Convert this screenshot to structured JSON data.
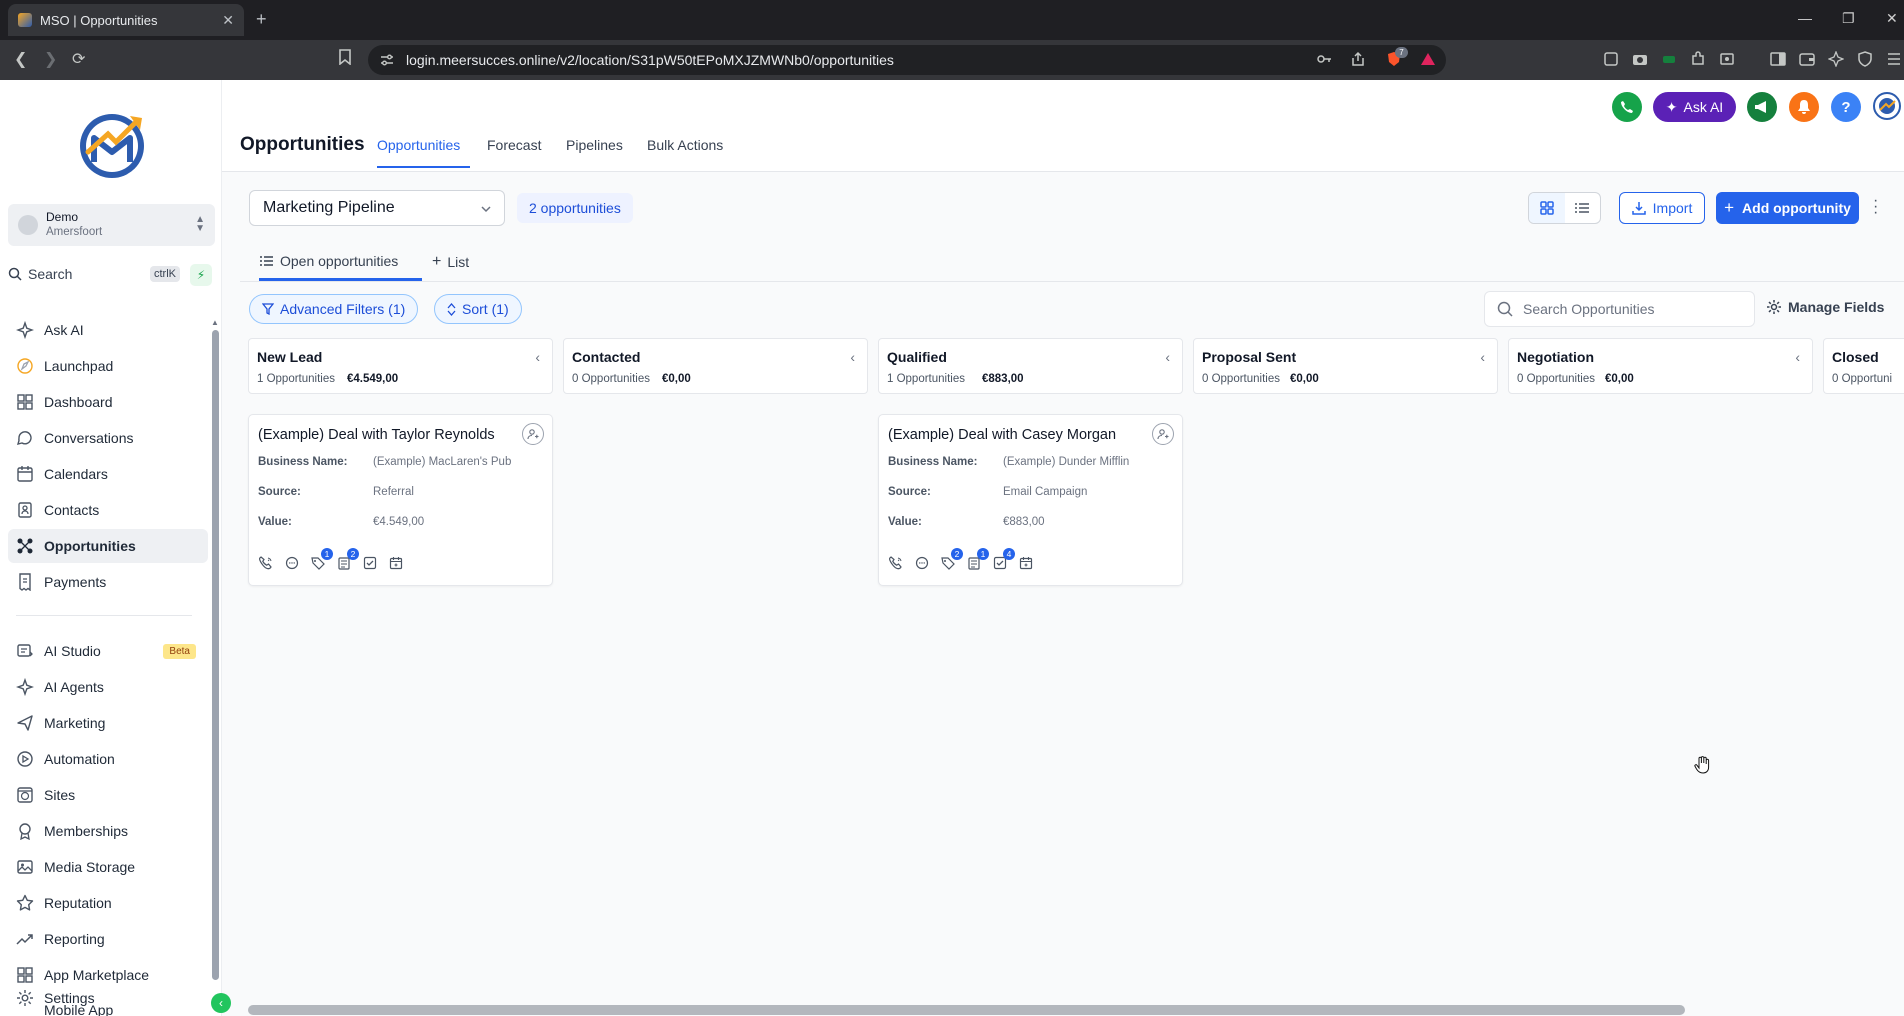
{
  "browser": {
    "tab_title": "MSO | Opportunities",
    "url": "login.meersucces.online/v2/location/S31pW50tEPoMXJZMWNb0/opportunities",
    "ext_badge_count": "7"
  },
  "sidebar": {
    "account_name": "Demo",
    "account_location": "Amersfoort",
    "search_label": "Search",
    "search_shortcut": "ctrlK",
    "items": [
      {
        "label": "Ask AI",
        "icon": "sparkle-icon"
      },
      {
        "label": "Launchpad",
        "icon": "rocket-icon"
      },
      {
        "label": "Dashboard",
        "icon": "grid-icon"
      },
      {
        "label": "Conversations",
        "icon": "chat-icon"
      },
      {
        "label": "Calendars",
        "icon": "calendar-icon"
      },
      {
        "label": "Contacts",
        "icon": "contact-icon"
      },
      {
        "label": "Opportunities",
        "icon": "funnel-icon"
      },
      {
        "label": "Payments",
        "icon": "receipt-icon"
      }
    ],
    "items2": [
      {
        "label": "AI Studio",
        "icon": "ai-studio-icon",
        "badge": "Beta"
      },
      {
        "label": "AI Agents",
        "icon": "sparkle-icon"
      },
      {
        "label": "Marketing",
        "icon": "send-icon"
      },
      {
        "label": "Automation",
        "icon": "automation-icon"
      },
      {
        "label": "Sites",
        "icon": "globe-icon"
      },
      {
        "label": "Memberships",
        "icon": "award-icon"
      },
      {
        "label": "Media Storage",
        "icon": "image-icon"
      },
      {
        "label": "Reputation",
        "icon": "star-icon"
      },
      {
        "label": "Reporting",
        "icon": "trend-icon"
      },
      {
        "label": "App Marketplace",
        "icon": "apps-icon"
      },
      {
        "label": "Mobile App",
        "icon": "phone-icon"
      },
      {
        "label": "Settings",
        "icon": "gear-icon"
      }
    ]
  },
  "header": {
    "title": "Opportunities",
    "tabs": [
      "Opportunities",
      "Forecast",
      "Pipelines",
      "Bulk Actions"
    ],
    "ask_ai": "Ask AI",
    "help": "?"
  },
  "toolbar": {
    "pipeline": "Marketing Pipeline",
    "count": "2 opportunities",
    "import": "Import",
    "add": "Add opportunity"
  },
  "views": {
    "active": "Open opportunities",
    "add": "List"
  },
  "filters": {
    "advanced": "Advanced Filters (1)",
    "sort": "Sort (1)",
    "search_placeholder": "Search Opportunities",
    "manage_fields": "Manage Fields"
  },
  "stages": [
    {
      "name": "New Lead",
      "count": "1 Opportunities",
      "value": "€4.549,00"
    },
    {
      "name": "Contacted",
      "count": "0 Opportunities",
      "value": "€0,00"
    },
    {
      "name": "Qualified",
      "count": "1 Opportunities",
      "value": "€883,00"
    },
    {
      "name": "Proposal Sent",
      "count": "0 Opportunities",
      "value": "€0,00"
    },
    {
      "name": "Negotiation",
      "count": "0 Opportunities",
      "value": "€0,00"
    },
    {
      "name": "Closed",
      "count": "0 Opportuni"
    }
  ],
  "field_labels": {
    "business": "Business Name:",
    "source": "Source:",
    "value": "Value:"
  },
  "cards": [
    {
      "title": "(Example) Deal with Taylor Reynolds",
      "business": "(Example) MacLaren's Pub",
      "source": "Referral",
      "value": "€4.549,00",
      "badges": {
        "tag": "1",
        "notes": "2"
      }
    },
    {
      "title": "(Example) Deal with Casey Morgan",
      "business": "(Example) Dunder Mifflin",
      "source": "Email Campaign",
      "value": "€883,00",
      "badges": {
        "tag": "2",
        "notes": "1",
        "tasks": "4"
      }
    }
  ],
  "colors": {
    "primary": "#2563eb",
    "ask_ai": "#5b21b6",
    "phone": "#16a34a",
    "megaphone": "#15803d",
    "bell": "#f97316",
    "help": "#3b82f6"
  }
}
